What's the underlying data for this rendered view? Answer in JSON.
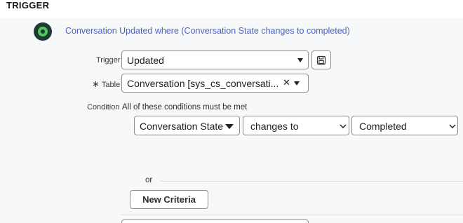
{
  "section": {
    "title": "TRIGGER"
  },
  "trigger_summary": "Conversation Updated where (Conversation State changes to completed)",
  "trigger_field": {
    "label": "Trigger",
    "value": "Updated",
    "save_icon": "floppy-disk-icon"
  },
  "table_field": {
    "required_marker": "∗",
    "label": "Table",
    "value": "Conversation [sys_cs_conversati...",
    "clear_symbol": "✕"
  },
  "condition": {
    "label": "Condition",
    "description": "All of these conditions must be met",
    "field": "Conversation State",
    "operator": "changes to",
    "value": "Completed"
  },
  "or_label": "or",
  "new_criteria_button": "New Criteria",
  "colors": {
    "link": "#4a64c8",
    "icon_dark": "#1d3a33",
    "icon_green": "#52c45d",
    "panel_bg": "#f7f8f9"
  }
}
